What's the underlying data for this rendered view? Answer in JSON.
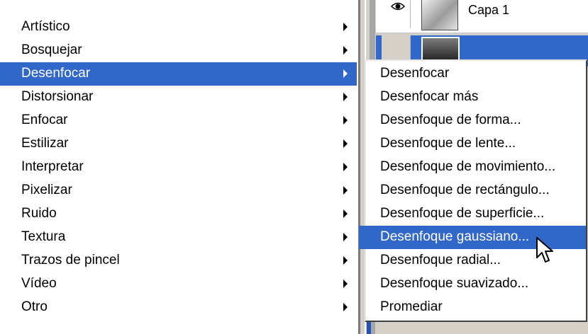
{
  "layers_panel": {
    "layers": [
      {
        "name": "Capa 1"
      },
      {
        "name": ""
      }
    ]
  },
  "filter_menu": {
    "items": [
      {
        "label": "Artístico"
      },
      {
        "label": "Bosquejar"
      },
      {
        "label": "Desenfocar"
      },
      {
        "label": "Distorsionar"
      },
      {
        "label": "Enfocar"
      },
      {
        "label": "Estilizar"
      },
      {
        "label": "Interpretar"
      },
      {
        "label": "Pixelizar"
      },
      {
        "label": "Ruido"
      },
      {
        "label": "Textura"
      },
      {
        "label": "Trazos de pincel"
      },
      {
        "label": "Vídeo"
      },
      {
        "label": "Otro"
      }
    ],
    "selected_index": 2
  },
  "submenu": {
    "items": [
      {
        "label": "Desenfocar"
      },
      {
        "label": "Desenfocar más"
      },
      {
        "label": "Desenfoque de forma..."
      },
      {
        "label": "Desenfoque de lente..."
      },
      {
        "label": "Desenfoque de movimiento..."
      },
      {
        "label": "Desenfoque de rectángulo..."
      },
      {
        "label": "Desenfoque de superficie..."
      },
      {
        "label": "Desenfoque gaussiano..."
      },
      {
        "label": "Desenfoque radial..."
      },
      {
        "label": "Desenfoque suavizado..."
      },
      {
        "label": "Promediar"
      }
    ],
    "selected_index": 7
  },
  "colors": {
    "highlight": "#3167c8",
    "menu_background": "#ffffff",
    "panel_background": "#d4d0c8"
  },
  "icons": {
    "submenu_arrow": "arrow-icon",
    "visibility": "eye-icon",
    "pointer": "cursor-icon"
  }
}
